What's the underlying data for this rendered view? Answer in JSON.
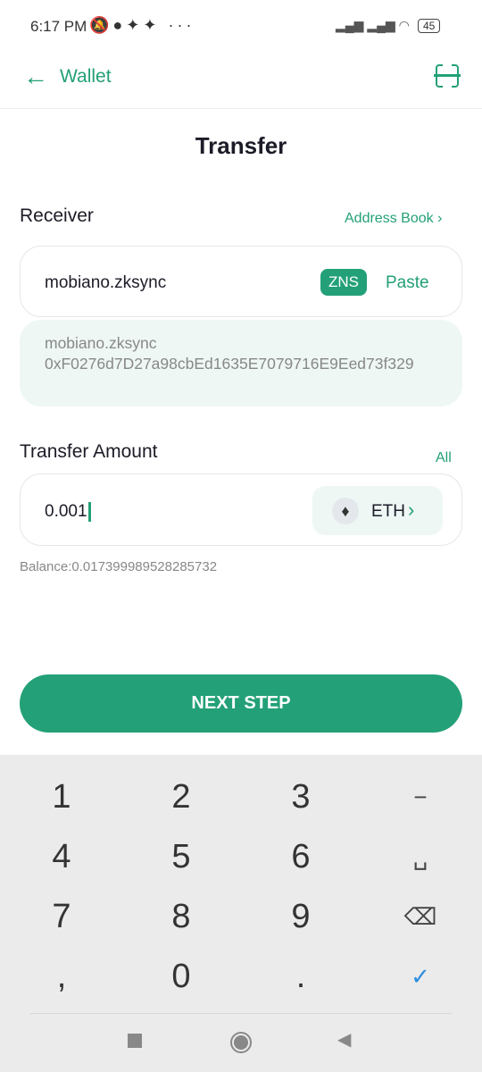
{
  "status_bar": {
    "time": "6:17 PM",
    "battery": "45",
    "icons": [
      "bell-muted-icon",
      "chat-icon",
      "twitter-icon",
      "twitter-icon",
      "more-icon",
      "signal-icon",
      "signal-icon",
      "wifi-icon",
      "battery-icon"
    ]
  },
  "header": {
    "back_label": "Wallet",
    "scan_icon": "scan-icon"
  },
  "page_title": "Transfer",
  "receiver": {
    "label": "Receiver",
    "address_book": "Address Book",
    "value": "mobiano.zksync",
    "zns_badge": "ZNS",
    "paste": "Paste",
    "resolved_name": "mobiano.zksync",
    "resolved_address": "0xF0276d7D27a98cbEd1635E7079716E9Eed73f329"
  },
  "amount": {
    "label": "Transfer Amount",
    "all": "All",
    "value": "0.001",
    "token": "ETH",
    "balance": "Balance:0.017399989528285732"
  },
  "next_button": "NEXT STEP",
  "keyboard": {
    "keys": [
      "1",
      "2",
      "3",
      "−",
      "4",
      "5",
      "6",
      "␣",
      "7",
      "8",
      "9",
      "⌫",
      ",",
      "0",
      ".",
      "✓"
    ]
  },
  "colors": {
    "accent": "#23a077",
    "light": "#eef7f4"
  }
}
